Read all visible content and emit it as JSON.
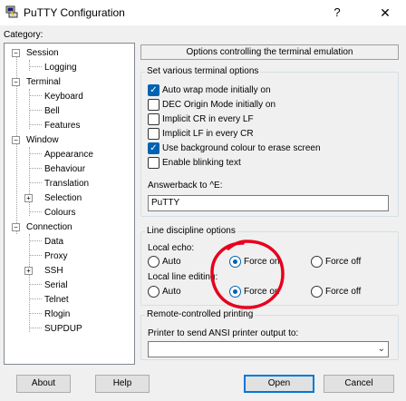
{
  "window": {
    "title": "PuTTY Configuration",
    "help_glyph": "?",
    "close_glyph": "✕",
    "icon": "putty-computer-icon"
  },
  "category_label": "Category:",
  "tree": {
    "items": [
      {
        "label": "Session",
        "expander": "−"
      },
      {
        "label": "Logging"
      },
      {
        "label": "Terminal",
        "expander": "−"
      },
      {
        "label": "Keyboard"
      },
      {
        "label": "Bell"
      },
      {
        "label": "Features"
      },
      {
        "label": "Window",
        "expander": "−"
      },
      {
        "label": "Appearance"
      },
      {
        "label": "Behaviour"
      },
      {
        "label": "Translation"
      },
      {
        "label": "Selection",
        "expander": "+"
      },
      {
        "label": "Colours"
      },
      {
        "label": "Connection",
        "expander": "−"
      },
      {
        "label": "Data"
      },
      {
        "label": "Proxy"
      },
      {
        "label": "SSH",
        "expander": "+"
      },
      {
        "label": "Serial"
      },
      {
        "label": "Telnet"
      },
      {
        "label": "Rlogin"
      },
      {
        "label": "SUPDUP"
      }
    ]
  },
  "panel": {
    "header": "Options controlling the terminal emulation",
    "terminal_options": {
      "title": "Set various terminal options",
      "checkboxes": [
        {
          "label": "Auto wrap mode initially on",
          "checked": true
        },
        {
          "label": "DEC Origin Mode initially on",
          "checked": false
        },
        {
          "label": "Implicit CR in every LF",
          "checked": false
        },
        {
          "label": "Implicit LF in every CR",
          "checked": false
        },
        {
          "label": "Use background colour to erase screen",
          "checked": true
        },
        {
          "label": "Enable blinking text",
          "checked": false
        }
      ],
      "answerback_label": "Answerback to ^E:",
      "answerback_value": "PuTTY"
    },
    "line_discipline": {
      "title": "Line discipline options",
      "local_echo_label": "Local echo:",
      "local_echo_options": [
        {
          "label": "Auto",
          "checked": false
        },
        {
          "label": "Force on",
          "checked": true
        },
        {
          "label": "Force off",
          "checked": false
        }
      ],
      "local_line_editing_label": "Local line editing:",
      "local_line_editing_options": [
        {
          "label": "Auto",
          "checked": false
        },
        {
          "label": "Force on",
          "checked": true
        },
        {
          "label": "Force off",
          "checked": false
        }
      ]
    },
    "remote_printing": {
      "title": "Remote-controlled printing",
      "printer_label": "Printer to send ANSI printer output to:",
      "printer_value": ""
    }
  },
  "buttons": {
    "about": "About",
    "help": "Help",
    "open": "Open",
    "cancel": "Cancel"
  },
  "colors": {
    "accent": "#0063b1",
    "annotation": "#e8001c"
  }
}
